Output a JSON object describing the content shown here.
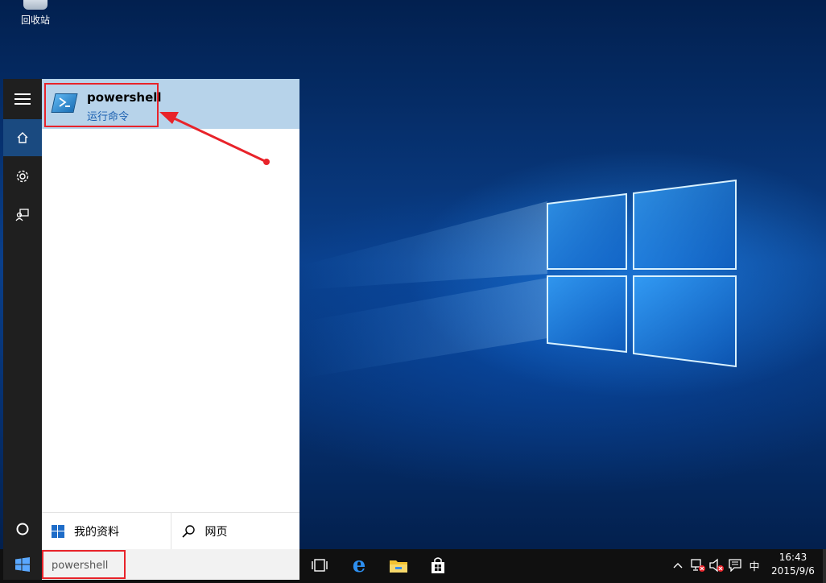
{
  "desktop": {
    "recycle_bin_label": "回收站"
  },
  "start_menu": {
    "rail": {
      "menu_icon": "hamburger-icon",
      "home_icon": "home-icon",
      "settings_icon": "gear-icon",
      "feedback_icon": "feedback-icon",
      "power_icon": "circle-icon"
    },
    "result": {
      "title": "powershell",
      "subtitle": "运行命令",
      "icon": "powershell-icon"
    },
    "bottom": {
      "my_stuff_label": "我的资料",
      "web_label": "网页"
    }
  },
  "taskbar": {
    "search_value": "powershell",
    "tray": {
      "ime_label": "中",
      "time": "16:43",
      "date": "2015/9/6"
    }
  },
  "colors": {
    "accent": "#1a4a80",
    "highlight": "#b7d3ea",
    "annotation_red": "#e8232a"
  }
}
